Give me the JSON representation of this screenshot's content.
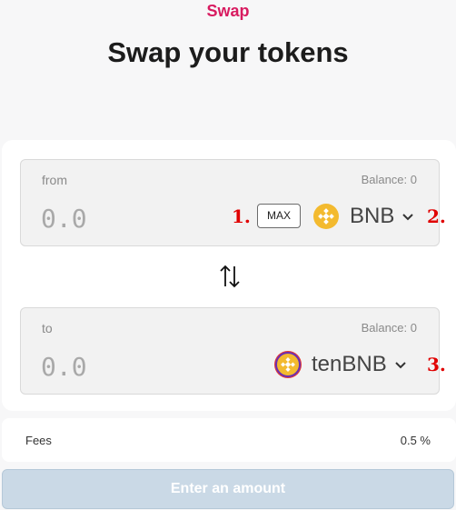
{
  "header": {
    "eyebrow": "Swap",
    "title": "Swap your tokens"
  },
  "from_panel": {
    "label": "from",
    "balance": "Balance: 0",
    "amount": "0.0",
    "max_label": "MAX",
    "token": "BNB",
    "token_icon": "bnb-icon"
  },
  "to_panel": {
    "label": "to",
    "balance": "Balance: 0",
    "amount": "0.0",
    "token": "tenBNB",
    "token_icon": "tenbnb-icon"
  },
  "callouts": {
    "one": "1.",
    "two": "2.",
    "three": "3."
  },
  "fees": {
    "label": "Fees",
    "value": "0.5 %"
  },
  "submit": {
    "label": "Enter an amount"
  },
  "colors": {
    "accent": "#d81b60",
    "callout": "#e00000",
    "bnb": "#f3ba2f",
    "disabled_button": "#cad9e6"
  }
}
